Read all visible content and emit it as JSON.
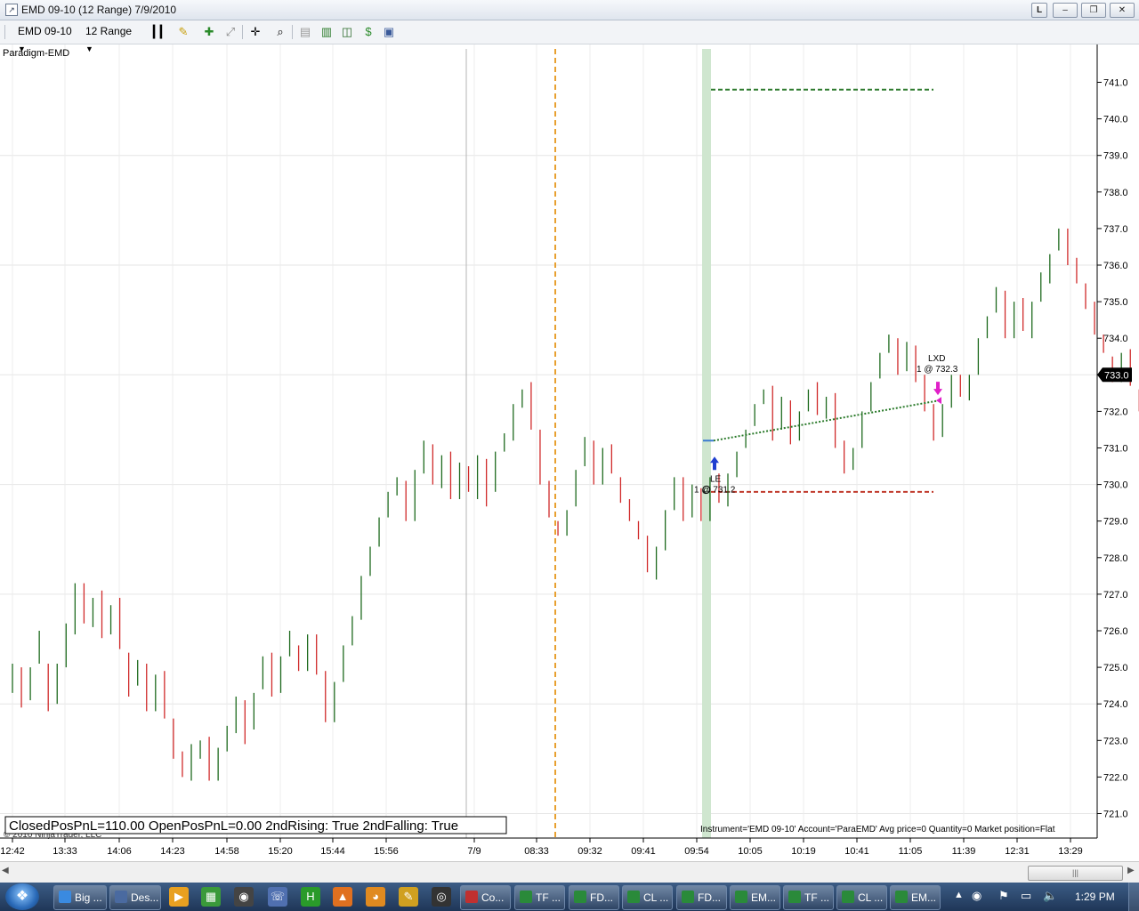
{
  "window": {
    "title": "EMD 09-10 (12 Range)  7/9/2010",
    "logo_letter": "L",
    "controls": [
      "L",
      "–",
      "❐",
      "✕"
    ]
  },
  "toolbar": {
    "instrument": "EMD 09-10",
    "period": "12 Range"
  },
  "chart": {
    "indicator_label": "Paradigm-EMD",
    "copyright": "© 2010 NinjaTrader, LLC",
    "strategy_box": "ClosedPosPnL=110.00 OpenPosPnL=0.00 2ndRising: True 2ndFalling: True",
    "account_info": "Instrument='EMD 09-10' Account='ParaEMD' Avg price=0 Quantity=0 Market position=Flat",
    "current_price": "733.0",
    "entry_label": "LE",
    "entry_fill": "1 @ 731.2",
    "exit_label": "LXD",
    "exit_fill": "1 @ 732.3",
    "colors": {
      "up": "#1e6a1e",
      "down": "#d02a2a",
      "target": "#2e7a2e",
      "stop": "#c0392b",
      "trade_line": "#2a7a2a",
      "highlight": "#cfe6cf",
      "session_line": "#e8a030",
      "entry_arrow": "#1f3fd0",
      "exit_arrow": "#e020c8"
    }
  },
  "chart_data": {
    "type": "range-bar (OHLC)",
    "instrument": "EMD 09-10",
    "bar_type": "12 Range",
    "y_ticks": [
      "741.0",
      "740.0",
      "739.0",
      "738.0",
      "737.0",
      "736.0",
      "735.0",
      "734.0",
      "733.0",
      "732.0",
      "731.0",
      "730.0",
      "729.0",
      "728.0",
      "727.0",
      "726.0",
      "725.0",
      "724.0",
      "723.0",
      "722.0",
      "721.0"
    ],
    "x_ticks": [
      "12:42",
      "13:33",
      "14:06",
      "14:23",
      "14:58",
      "15:20",
      "15:44",
      "15:56",
      "7/9",
      "08:33",
      "09:32",
      "09:41",
      "09:54",
      "10:05",
      "10:19",
      "10:41",
      "11:05",
      "11:39",
      "12:31",
      "13:29"
    ],
    "ylim": [
      720.6,
      741.8
    ],
    "profit_target": 740.8,
    "stop_loss": 729.8,
    "entry": {
      "price": 731.2,
      "qty": 1,
      "label": "LE"
    },
    "exit": {
      "price": 732.3,
      "qty": 1,
      "label": "LXD"
    },
    "last_price": 733.0,
    "bars": [
      {
        "o": 724.3,
        "c": 725.1
      },
      {
        "o": 725.0,
        "c": 723.9
      },
      {
        "o": 724.1,
        "c": 725.0
      },
      {
        "o": 725.1,
        "c": 726.0
      },
      {
        "o": 725.1,
        "c": 723.8
      },
      {
        "o": 724.0,
        "c": 725.1
      },
      {
        "o": 725.0,
        "c": 726.2
      },
      {
        "o": 725.9,
        "c": 727.3
      },
      {
        "o": 727.3,
        "c": 726.2
      },
      {
        "o": 726.1,
        "c": 726.9
      },
      {
        "o": 727.1,
        "c": 725.8
      },
      {
        "o": 725.9,
        "c": 726.7
      },
      {
        "o": 726.9,
        "c": 725.5
      },
      {
        "o": 725.4,
        "c": 724.2
      },
      {
        "o": 724.5,
        "c": 725.2
      },
      {
        "o": 725.1,
        "c": 723.8
      },
      {
        "o": 723.8,
        "c": 724.8
      },
      {
        "o": 724.9,
        "c": 723.6
      },
      {
        "o": 723.6,
        "c": 722.5
      },
      {
        "o": 722.7,
        "c": 722.0
      },
      {
        "o": 721.9,
        "c": 722.9
      },
      {
        "o": 722.5,
        "c": 723.0
      },
      {
        "o": 723.1,
        "c": 721.9
      },
      {
        "o": 721.9,
        "c": 722.8
      },
      {
        "o": 722.7,
        "c": 723.4
      },
      {
        "o": 723.2,
        "c": 724.2
      },
      {
        "o": 724.1,
        "c": 722.9
      },
      {
        "o": 723.3,
        "c": 724.3
      },
      {
        "o": 724.4,
        "c": 725.3
      },
      {
        "o": 725.4,
        "c": 724.2
      },
      {
        "o": 724.3,
        "c": 725.3
      },
      {
        "o": 725.3,
        "c": 726.0
      },
      {
        "o": 725.6,
        "c": 724.9
      },
      {
        "o": 724.9,
        "c": 725.9
      },
      {
        "o": 725.9,
        "c": 724.8
      },
      {
        "o": 724.9,
        "c": 723.5
      },
      {
        "o": 723.5,
        "c": 724.6
      },
      {
        "o": 724.6,
        "c": 725.6
      },
      {
        "o": 725.6,
        "c": 726.4
      },
      {
        "o": 726.3,
        "c": 727.5
      },
      {
        "o": 727.5,
        "c": 728.3
      },
      {
        "o": 728.3,
        "c": 729.1
      },
      {
        "o": 729.1,
        "c": 729.8
      },
      {
        "o": 729.7,
        "c": 730.2
      },
      {
        "o": 730.1,
        "c": 729.0
      },
      {
        "o": 729.0,
        "c": 730.4
      },
      {
        "o": 730.3,
        "c": 731.2
      },
      {
        "o": 731.1,
        "c": 730.0
      },
      {
        "o": 729.9,
        "c": 730.8
      },
      {
        "o": 730.9,
        "c": 729.6
      },
      {
        "o": 729.6,
        "c": 730.6
      },
      {
        "o": 730.5,
        "c": 729.8
      },
      {
        "o": 729.6,
        "c": 730.8
      },
      {
        "o": 730.7,
        "c": 729.4
      },
      {
        "o": 729.8,
        "c": 730.9
      },
      {
        "o": 730.9,
        "c": 731.4
      },
      {
        "o": 731.2,
        "c": 732.2
      },
      {
        "o": 732.1,
        "c": 732.6
      },
      {
        "o": 732.8,
        "c": 731.5
      },
      {
        "o": 731.5,
        "c": 730.0
      },
      {
        "o": 730.1,
        "c": 729.1
      },
      {
        "o": 729.0,
        "c": 728.6
      },
      {
        "o": 728.6,
        "c": 729.3
      },
      {
        "o": 729.4,
        "c": 730.4
      },
      {
        "o": 730.5,
        "c": 731.3
      },
      {
        "o": 731.2,
        "c": 730.0
      },
      {
        "o": 730.0,
        "c": 731.0
      },
      {
        "o": 731.1,
        "c": 730.3
      },
      {
        "o": 730.2,
        "c": 729.5
      },
      {
        "o": 729.6,
        "c": 729.0
      },
      {
        "o": 729.0,
        "c": 728.5
      },
      {
        "o": 728.6,
        "c": 727.6
      },
      {
        "o": 727.4,
        "c": 728.3
      },
      {
        "o": 728.2,
        "c": 729.3
      },
      {
        "o": 729.3,
        "c": 730.2
      },
      {
        "o": 730.2,
        "c": 729.0
      },
      {
        "o": 729.1,
        "c": 730.0
      },
      {
        "o": 729.9,
        "c": 729.0
      },
      {
        "o": 729.0,
        "c": 730.2
      },
      {
        "o": 730.3,
        "c": 729.5
      },
      {
        "o": 729.4,
        "c": 730.3
      },
      {
        "o": 730.2,
        "c": 730.9
      },
      {
        "o": 731.0,
        "c": 731.5
      },
      {
        "o": 731.6,
        "c": 732.2
      },
      {
        "o": 732.2,
        "c": 732.6
      },
      {
        "o": 732.7,
        "c": 731.2
      },
      {
        "o": 731.5,
        "c": 732.4
      },
      {
        "o": 732.3,
        "c": 731.1
      },
      {
        "o": 731.2,
        "c": 732.0
      },
      {
        "o": 732.0,
        "c": 732.6
      },
      {
        "o": 732.8,
        "c": 731.9
      },
      {
        "o": 731.8,
        "c": 732.4
      },
      {
        "o": 732.5,
        "c": 731.0
      },
      {
        "o": 731.2,
        "c": 730.3
      },
      {
        "o": 730.4,
        "c": 731.0
      },
      {
        "o": 731.0,
        "c": 732.0
      },
      {
        "o": 732.0,
        "c": 732.8
      },
      {
        "o": 732.9,
        "c": 733.6
      },
      {
        "o": 733.6,
        "c": 734.1
      },
      {
        "o": 734.0,
        "c": 733.0
      },
      {
        "o": 733.1,
        "c": 733.9
      },
      {
        "o": 733.8,
        "c": 732.8
      },
      {
        "o": 733.0,
        "c": 732.0
      },
      {
        "o": 732.2,
        "c": 731.2
      },
      {
        "o": 731.3,
        "c": 732.2
      },
      {
        "o": 732.1,
        "c": 733.0
      },
      {
        "o": 733.0,
        "c": 732.4
      },
      {
        "o": 732.3,
        "c": 733.0
      },
      {
        "o": 733.0,
        "c": 734.0
      },
      {
        "o": 734.0,
        "c": 734.6
      },
      {
        "o": 734.7,
        "c": 735.4
      },
      {
        "o": 735.3,
        "c": 734.0
      },
      {
        "o": 734.0,
        "c": 735.0
      },
      {
        "o": 735.1,
        "c": 734.2
      },
      {
        "o": 734.0,
        "c": 735.0
      },
      {
        "o": 735.0,
        "c": 735.8
      },
      {
        "o": 735.5,
        "c": 736.3
      },
      {
        "o": 736.4,
        "c": 737.0
      },
      {
        "o": 737.0,
        "c": 736.0
      },
      {
        "o": 736.2,
        "c": 735.5
      },
      {
        "o": 735.5,
        "c": 734.8
      },
      {
        "o": 735.0,
        "c": 734.1
      },
      {
        "o": 734.1,
        "c": 733.6
      },
      {
        "o": 733.5,
        "c": 732.8
      },
      {
        "o": 732.8,
        "c": 733.6
      },
      {
        "o": 733.7,
        "c": 732.7
      },
      {
        "o": 732.6,
        "c": 732.0
      },
      {
        "o": 731.9,
        "c": 732.8
      },
      {
        "o": 732.9,
        "c": 732.3
      },
      {
        "o": 732.2,
        "c": 731.5
      },
      {
        "o": 731.4,
        "c": 732.4
      },
      {
        "o": 732.5,
        "c": 733.2
      },
      {
        "o": 733.3,
        "c": 734.1
      },
      {
        "o": 734.0,
        "c": 733.0
      },
      {
        "o": 733.1,
        "c": 732.5
      },
      {
        "o": 732.6,
        "c": 733.4
      },
      {
        "o": 733.4,
        "c": 732.7
      },
      {
        "o": 732.6,
        "c": 733.6
      },
      {
        "o": 733.6,
        "c": 732.6
      },
      {
        "o": 732.7,
        "c": 733.5
      },
      {
        "o": 733.4,
        "c": 732.3
      },
      {
        "o": 732.3,
        "c": 733.0
      },
      {
        "o": 732.9,
        "c": 733.6
      },
      {
        "o": 733.6,
        "c": 732.8
      },
      {
        "o": 732.6,
        "c": 733.4
      },
      {
        "o": 733.5,
        "c": 733.9
      },
      {
        "o": 733.9,
        "c": 732.8
      },
      {
        "o": 732.8,
        "c": 733.2
      }
    ]
  },
  "scrollbar": {
    "thumb_glyph": "|||"
  },
  "taskbar": {
    "start_glyph": "❖",
    "quicklaunch": [
      {
        "name": "media-player-icon",
        "color": "#e8a020",
        "glyph": "▶"
      },
      {
        "name": "app-tiles-icon",
        "color": "#3a9a3a",
        "glyph": "▦"
      },
      {
        "name": "camera-icon",
        "color": "#444444",
        "glyph": "◉"
      },
      {
        "name": "phone-icon",
        "color": "#5070b0",
        "glyph": "☏"
      },
      {
        "name": "green-app-icon",
        "color": "#2a9a2a",
        "glyph": "H"
      },
      {
        "name": "cone-icon",
        "color": "#e07020",
        "glyph": "▲"
      },
      {
        "name": "firefox-icon",
        "color": "#e08a20",
        "glyph": "◕"
      },
      {
        "name": "pen-icon",
        "color": "#d0a020",
        "glyph": "✎"
      },
      {
        "name": "circle-tool-icon",
        "color": "#333333",
        "glyph": "◎"
      }
    ],
    "tasks": [
      "Big ...",
      "Des...",
      "Co...",
      "TF ...",
      "FD...",
      "CL ...",
      "FD...",
      "EM...",
      "TF ...",
      "CL ...",
      "EM..."
    ],
    "clock": "1:29 PM"
  }
}
